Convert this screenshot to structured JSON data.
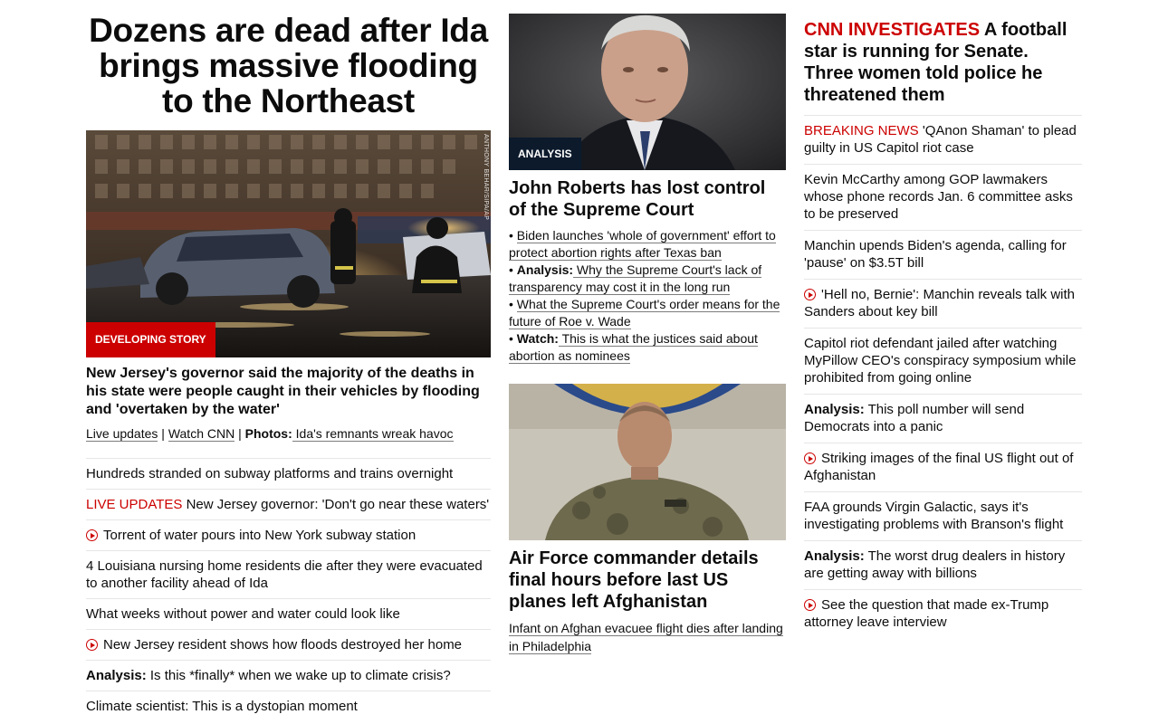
{
  "left": {
    "headline": "Dozens are dead after Ida brings massive flooding to the Northeast",
    "badge": "DEVELOPING STORY",
    "photo_credit": "ANTHONY BEHAR/SIPA/AP",
    "lead": "New Jersey's governor said the majority of the deaths in his state were people caught in their vehicles by flooding and 'overtaken by the water'",
    "sublinks": {
      "live_updates": "Live updates",
      "sep1": " | ",
      "watch": "Watch CNN",
      "sep2": " | ",
      "photos_label": "Photos:",
      "photos_text": " Ida's remnants wreak havoc"
    },
    "items": [
      {
        "text": "Hundreds stranded on subway platforms and trains overnight"
      },
      {
        "kicker": "LIVE UPDATES",
        "text": " New Jersey governor: 'Don't go near these waters'"
      },
      {
        "video": true,
        "text": "Torrent of water pours into New York subway station"
      },
      {
        "text": "4 Louisiana nursing home residents die after they were evacuated to another facility ahead of Ida"
      },
      {
        "text": "What weeks without power and water could look like"
      },
      {
        "video": true,
        "text": "New Jersey resident shows how floods destroyed her home"
      },
      {
        "label": "Analysis:",
        "text": " Is this *finally* when we wake up to climate crisis?"
      },
      {
        "text": "Climate scientist: This is a dystopian moment"
      }
    ]
  },
  "middle": {
    "story1": {
      "badge": "ANALYSIS",
      "title": "John Roberts has lost control of the Supreme Court",
      "bullets": [
        {
          "text": "Biden launches 'whole of government' effort to protect abortion rights after Texas ban"
        },
        {
          "label": "Analysis:",
          "text": " Why the Supreme Court's lack of transparency may cost it in the long run"
        },
        {
          "text": "What the Supreme Court's order means for the future of Roe v. Wade"
        },
        {
          "label": "Watch:",
          "text": " This is what the justices said about abortion as nominees"
        }
      ]
    },
    "story2": {
      "title": "Air Force commander details final hours before last US planes left Afghanistan",
      "sublink": "Infant on Afghan evacuee flight dies after landing in Philadelphia"
    }
  },
  "right": {
    "top_kicker": "CNN INVESTIGATES",
    "top_text": " A football star is running for Senate. Three women told police he threatened them",
    "items": [
      {
        "kicker": "BREAKING NEWS",
        "text": " 'QAnon Shaman' to plead guilty in US Capitol riot case"
      },
      {
        "text": "Kevin McCarthy among GOP lawmakers whose phone records Jan. 6 committee asks to be preserved"
      },
      {
        "text": "Manchin upends Biden's agenda, calling for 'pause' on $3.5T bill"
      },
      {
        "video": true,
        "text": "'Hell no, Bernie': Manchin reveals talk with Sanders about key bill"
      },
      {
        "text": "Capitol riot defendant jailed after watching MyPillow CEO's conspiracy symposium while prohibited from going online"
      },
      {
        "label": "Analysis:",
        "text": " This poll number will send Democrats into a panic"
      },
      {
        "video": true,
        "text": "Striking images of the final US flight out of Afghanistan"
      },
      {
        "text": "FAA grounds Virgin Galactic, says it's investigating problems with Branson's flight"
      },
      {
        "label": "Analysis:",
        "text": " The worst drug dealers in history are getting away with billions"
      },
      {
        "video": true,
        "text": "See the question that made ex-Trump attorney leave interview"
      }
    ]
  },
  "colors": {
    "accent_red": "#cc0000",
    "navy": "#0c1a2c",
    "divider": "#e6e6e6"
  }
}
